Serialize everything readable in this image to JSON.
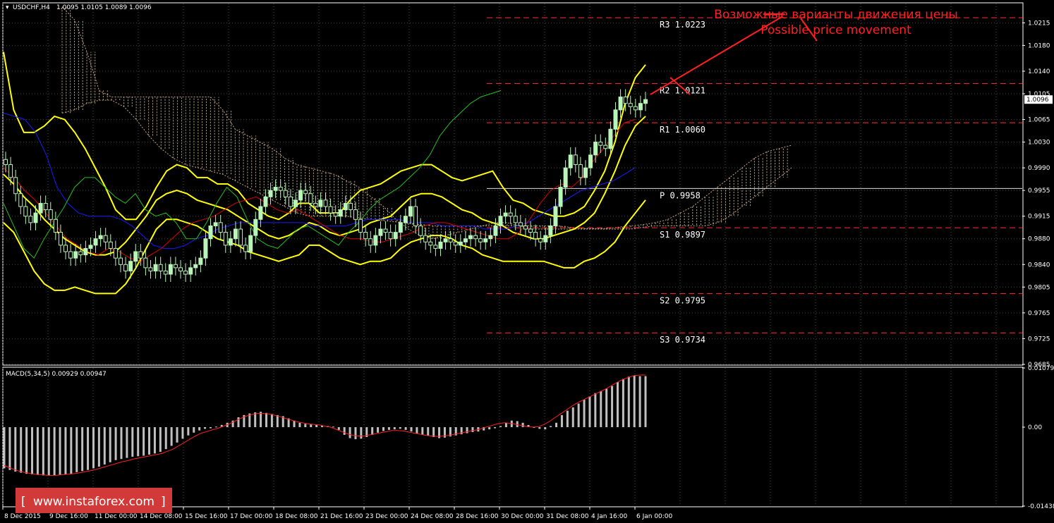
{
  "header": {
    "symbol": "USDCHF,H4",
    "ohlc": "1.0095 1.0105 1.0089 1.0096",
    "macd_label": "MACD(5,34,5) 0.00929 0.00947"
  },
  "annotation": {
    "line_ru": "Возможные варианты движения цены",
    "line_en": "Possible price movement"
  },
  "logo": {
    "text": "www.instaforex.com",
    "bracket_left": "[",
    "bracket_right": "]"
  },
  "current_price": {
    "label": "1.0096",
    "value": 1.0096
  },
  "colors": {
    "background": "#000000",
    "grid": "#3a4a3a",
    "axis": "#ffffff",
    "bull_candle": "#b9f5b9",
    "bear_candle": "#000000",
    "wick": "#b9f5b9",
    "bollinger": "#ffff00",
    "level_line": "#ff3030",
    "macd_hist": "#c0c0c0",
    "macd_signal": "#ff2020",
    "ichimoku_tenkan": "#e00000",
    "ichimoku_kijun": "#1a1aff",
    "ichimoku_chikou": "#22c022",
    "ichimoku_cloud": "#d9c7a7",
    "annotation": "#ff2020",
    "logo_bg": "#d23a3a"
  },
  "chart_data": [
    {
      "type": "candlestick",
      "title": "USDCHF,H4",
      "ylim": [
        0.9685,
        1.0245
      ],
      "y_ticks": [
        "1.0215",
        "1.0180",
        "1.0140",
        "1.0105",
        "1.0065",
        "1.0030",
        "0.9990",
        "0.9955",
        "0.9915",
        "0.9880",
        "0.9840",
        "0.9805",
        "0.9765",
        "0.9725",
        "0.9685"
      ],
      "x_ticks": [
        "8 Dec 2015",
        "9 Dec 16:00",
        "11 Dec 00:00",
        "14 Dec 08:00",
        "15 Dec 16:00",
        "17 Dec 00:00",
        "18 Dec 08:00",
        "21 Dec 16:00",
        "23 Dec 00:00",
        "24 Dec 08:00",
        "28 Dec 16:00",
        "30 Dec 00:00",
        "31 Dec 08:00",
        "4 Jan 16:00",
        "6 Jan 00:00"
      ],
      "pivot_levels": [
        {
          "name": "R3",
          "label": "R3  1.0223",
          "value": 1.0223
        },
        {
          "name": "R2",
          "label": "R2  1.0121",
          "value": 1.0121
        },
        {
          "name": "R1",
          "label": "R1  1.0060",
          "value": 1.006
        },
        {
          "name": "P",
          "label": " P  0.9958",
          "value": 0.9958
        },
        {
          "name": "S1",
          "label": "S1  0.9897",
          "value": 0.9897
        },
        {
          "name": "S2",
          "label": "S2  0.9795",
          "value": 0.9795
        },
        {
          "name": "S3",
          "label": "S3  0.9734",
          "value": 0.9734
        }
      ],
      "close": [
        0.9995,
        0.9975,
        0.995,
        0.993,
        0.9915,
        0.9905,
        0.992,
        0.9935,
        0.9925,
        0.991,
        0.989,
        0.987,
        0.986,
        0.985,
        0.986,
        0.9855,
        0.9865,
        0.987,
        0.988,
        0.9885,
        0.9875,
        0.9865,
        0.985,
        0.984,
        0.983,
        0.9845,
        0.986,
        0.985,
        0.9835,
        0.983,
        0.984,
        0.983,
        0.9825,
        0.984,
        0.9835,
        0.983,
        0.9825,
        0.9835,
        0.984,
        0.985,
        0.988,
        0.99,
        0.9905,
        0.989,
        0.987,
        0.988,
        0.9895,
        0.987,
        0.986,
        0.9885,
        0.991,
        0.993,
        0.9945,
        0.9955,
        0.996,
        0.9955,
        0.9945,
        0.993,
        0.994,
        0.9955,
        0.995,
        0.9935,
        0.993,
        0.994,
        0.993,
        0.992,
        0.9915,
        0.9925,
        0.9935,
        0.9925,
        0.991,
        0.989,
        0.988,
        0.987,
        0.9885,
        0.9895,
        0.989,
        0.988,
        0.989,
        0.9905,
        0.9915,
        0.993,
        0.99,
        0.9885,
        0.9875,
        0.987,
        0.9865,
        0.9875,
        0.988,
        0.9875,
        0.987,
        0.9875,
        0.988,
        0.9885,
        0.988,
        0.9875,
        0.988,
        0.9885,
        0.99,
        0.9915,
        0.992,
        0.9915,
        0.9905,
        0.99,
        0.9895,
        0.989,
        0.988,
        0.9875,
        0.9885,
        0.99,
        0.993,
        0.996,
        0.999,
        1.001,
        0.9995,
        0.9975,
        0.999,
        1.001,
        1.003,
        1.0025,
        1.002,
        1.005,
        1.008,
        1.01,
        1.009,
        1.0085,
        1.008,
        1.009,
        1.0096
      ],
      "bollinger_upper": [
        1.017,
        1.008,
        1.0045,
        1.0045,
        1.0055,
        1.007,
        1.0065,
        1.0045,
        1.002,
        0.999,
        0.996,
        0.9925,
        0.991,
        0.991,
        0.993,
        0.996,
        0.9985,
        0.9995,
        0.999,
        0.9975,
        0.9975,
        0.9965,
        0.9965,
        0.9955,
        0.9935,
        0.9925,
        0.9915,
        0.991,
        0.992,
        0.9935,
        0.9935,
        0.992,
        0.992,
        0.992,
        0.994,
        0.9955,
        0.996,
        0.9965,
        0.9975,
        0.9985,
        0.999,
        0.9995,
        0.9995,
        0.9985,
        0.9975,
        0.997,
        0.9975,
        0.998,
        0.9985,
        0.996,
        0.994,
        0.9935,
        0.9925,
        0.992,
        0.9915,
        0.9915,
        0.992,
        0.993,
        0.9955,
        0.9985,
        1.003,
        1.009,
        1.013,
        1.015
      ],
      "bollinger_middle": [
        0.998,
        0.9965,
        0.9945,
        0.993,
        0.991,
        0.9895,
        0.988,
        0.987,
        0.986,
        0.9855,
        0.9855,
        0.986,
        0.9875,
        0.9895,
        0.9915,
        0.994,
        0.995,
        0.9955,
        0.995,
        0.994,
        0.9935,
        0.993,
        0.9925,
        0.9915,
        0.9905,
        0.9895,
        0.9885,
        0.988,
        0.9885,
        0.9895,
        0.9905,
        0.99,
        0.989,
        0.9885,
        0.989,
        0.9895,
        0.9905,
        0.991,
        0.9915,
        0.993,
        0.9945,
        0.995,
        0.995,
        0.9945,
        0.9935,
        0.9925,
        0.992,
        0.991,
        0.9905,
        0.99,
        0.989,
        0.9885,
        0.988,
        0.988,
        0.9885,
        0.989,
        0.9895,
        0.9905,
        0.992,
        0.995,
        0.9985,
        1.0025,
        1.0055,
        1.007
      ],
      "bollinger_lower": [
        0.9905,
        0.989,
        0.986,
        0.983,
        0.981,
        0.98,
        0.98,
        0.9805,
        0.98,
        0.9795,
        0.9795,
        0.9795,
        0.981,
        0.9835,
        0.9865,
        0.9895,
        0.991,
        0.991,
        0.9905,
        0.99,
        0.989,
        0.988,
        0.9875,
        0.987,
        0.986,
        0.9855,
        0.985,
        0.9845,
        0.985,
        0.9855,
        0.987,
        0.987,
        0.986,
        0.985,
        0.9845,
        0.984,
        0.9845,
        0.9845,
        0.985,
        0.9865,
        0.9875,
        0.988,
        0.9885,
        0.9885,
        0.988,
        0.987,
        0.9865,
        0.9855,
        0.985,
        0.9845,
        0.9845,
        0.9845,
        0.9845,
        0.9845,
        0.984,
        0.9835,
        0.9835,
        0.9845,
        0.985,
        0.986,
        0.9875,
        0.99,
        0.992,
        0.994
      ],
      "tenkan": [
        0.999,
        0.9975,
        0.9955,
        0.994,
        0.992,
        0.99,
        0.988,
        0.987,
        0.986,
        0.9855,
        0.9865,
        0.986,
        0.985,
        0.9845,
        0.9855,
        0.9865,
        0.988,
        0.9895,
        0.9905,
        0.991,
        0.9915,
        0.9925,
        0.9935,
        0.994,
        0.9945,
        0.9935,
        0.9925,
        0.992,
        0.9925,
        0.9915,
        0.9905,
        0.9895,
        0.9885,
        0.988,
        0.988,
        0.9875,
        0.9875,
        0.988,
        0.9885,
        0.989,
        0.99,
        0.9905,
        0.9905,
        0.99,
        0.9895,
        0.989,
        0.9885,
        0.988,
        0.988,
        0.989,
        0.991,
        0.9935,
        0.9955,
        0.9965,
        0.996,
        0.9975,
        1.0,
        1.002,
        1.004,
        1.006,
        1.0065
      ],
      "kijun": [
        1.0075,
        1.007,
        1.0065,
        1.0045,
        1.001,
        0.996,
        0.9935,
        0.992,
        0.9915,
        0.9915,
        0.9915,
        0.991,
        0.99,
        0.9885,
        0.987,
        0.9865,
        0.9865,
        0.987,
        0.988,
        0.9885,
        0.9895,
        0.99,
        0.9905,
        0.9905,
        0.9905,
        0.9905,
        0.9905,
        0.9905,
        0.9905,
        0.99,
        0.99,
        0.99,
        0.99,
        0.9905,
        0.991,
        0.991,
        0.991,
        0.991,
        0.9905,
        0.9905,
        0.9905,
        0.99,
        0.99,
        0.99,
        0.99,
        0.9895,
        0.9895,
        0.9895,
        0.99,
        0.9905,
        0.9915,
        0.9925,
        0.9935,
        0.9945,
        0.9955,
        0.996,
        0.9965,
        0.997,
        0.998,
        0.999
      ],
      "chikou": [
        0.9935,
        0.99,
        0.9865,
        0.985,
        0.988,
        0.9905,
        0.993,
        0.996,
        0.9975,
        0.9975,
        0.996,
        0.9945,
        0.9935,
        0.995,
        0.9925,
        0.9915,
        0.992,
        0.9905,
        0.988,
        0.988,
        0.9905,
        0.9935,
        0.996,
        0.9945,
        0.991,
        0.988,
        0.987,
        0.9865,
        0.988,
        0.9895,
        0.99,
        0.989,
        0.988,
        0.987,
        0.989,
        0.9905,
        0.9925,
        0.994,
        0.995,
        0.996,
        0.9975,
        0.999,
        1.001,
        1.004,
        1.006,
        1.0075,
        1.009,
        1.01,
        1.0105,
        1.011
      ],
      "senkou_a": [
        1.0075,
        1.008,
        1.009,
        1.0095,
        1.0095,
        1.0085,
        1.0065,
        1.004,
        1.002,
        1.0005,
        0.9995,
        0.999,
        0.9985,
        0.998,
        0.997,
        0.996,
        0.995,
        0.994,
        0.993,
        0.992,
        0.9915,
        0.9915,
        0.9915,
        0.9915,
        0.9912,
        0.991,
        0.9908,
        0.9906,
        0.9904,
        0.9902,
        0.99,
        0.99,
        0.99,
        0.99,
        0.99,
        0.99,
        0.99,
        0.99,
        0.99,
        0.99,
        0.99,
        0.9898,
        0.9896,
        0.9896,
        0.9896,
        0.9898,
        0.99,
        0.9902,
        0.9905,
        0.991,
        0.992,
        0.993,
        0.9945,
        0.996,
        0.9975,
        0.999,
        1.0005,
        1.0015,
        1.002,
        1.0025
      ],
      "senkou_b": [
        1.024,
        1.022,
        1.017,
        1.011,
        1.01,
        1.01,
        1.01,
        1.01,
        1.01,
        1.01,
        1.01,
        1.01,
        1.01,
        1.008,
        1.005,
        1.004,
        1.003,
        1.002,
        1.0005,
        0.9995,
        0.999,
        0.9985,
        0.998,
        0.997,
        0.996,
        0.9945,
        0.993,
        0.991,
        0.9895,
        0.9885,
        0.988,
        0.9885,
        0.989,
        0.9895,
        0.99,
        0.9905,
        0.9905,
        0.99,
        0.9895,
        0.9895,
        0.9895,
        0.9895,
        0.9895,
        0.9895,
        0.9895,
        0.9895,
        0.9895,
        0.9898,
        0.99,
        0.99,
        0.99,
        0.99,
        0.99,
        0.9905,
        0.9915,
        0.993,
        0.9945,
        0.996,
        0.9975,
        0.999
      ]
    },
    {
      "type": "bar",
      "title": "MACD(5,34,5) 0.00929 0.00947",
      "ylim": [
        -0.01438,
        0.01079
      ],
      "y_ticks": [
        "0.01079",
        "0.00",
        "-0.01438"
      ],
      "histogram": [
        -0.0075,
        -0.0078,
        -0.0081,
        -0.0083,
        -0.0085,
        -0.0086,
        -0.0087,
        -0.0088,
        -0.0088,
        -0.0088,
        -0.0087,
        -0.0086,
        -0.0085,
        -0.0082,
        -0.008,
        -0.0078,
        -0.0075,
        -0.0072,
        -0.0068,
        -0.0064,
        -0.006,
        -0.0058,
        -0.0056,
        -0.0054,
        -0.0053,
        -0.0052,
        -0.005,
        -0.0048,
        -0.0045,
        -0.004,
        -0.0034,
        -0.0028,
        -0.0021,
        -0.0015,
        -0.001,
        -0.0006,
        -0.0003,
        -0.0002,
        0.0001,
        0.0004,
        0.0008,
        0.0012,
        0.0018,
        0.0022,
        0.0025,
        0.0027,
        0.0028,
        0.0026,
        0.0024,
        0.0022,
        0.002,
        0.0016,
        0.0012,
        0.0008,
        0.0006,
        0.0005,
        0.0004,
        0.0003,
        0.0002,
        0.0001,
        -0.0005,
        -0.0014,
        -0.002,
        -0.0022,
        -0.0021,
        -0.0018,
        -0.0014,
        -0.001,
        -0.0007,
        -0.0005,
        -0.0004,
        -0.0003,
        -0.0005,
        -0.0008,
        -0.0012,
        -0.0014,
        -0.0016,
        -0.0018,
        -0.002,
        -0.0019,
        -0.0017,
        -0.0015,
        -0.0013,
        -0.0011,
        -0.0009,
        -0.0008,
        -0.0006,
        -0.0004,
        -0.0002,
        0.0002,
        0.0008,
        0.0012,
        0.0011,
        0.0008,
        0.0004,
        0.0,
        -0.0003,
        -0.0004,
        0.0002,
        0.0008,
        0.0022,
        0.003,
        0.0036,
        0.0043,
        0.005,
        0.0056,
        0.0062,
        0.0066,
        0.007,
        0.0075,
        0.0082,
        0.0088,
        0.0092,
        0.0094,
        0.0093,
        0.0093
      ],
      "signal": [
        -0.007,
        -0.0074,
        -0.0078,
        -0.0081,
        -0.0083,
        -0.0085,
        -0.0086,
        -0.0087,
        -0.0088,
        -0.0088,
        -0.0087,
        -0.0086,
        -0.0085,
        -0.0084,
        -0.0082,
        -0.008,
        -0.0078,
        -0.0075,
        -0.0072,
        -0.0069,
        -0.0066,
        -0.0063,
        -0.0061,
        -0.0058,
        -0.0056,
        -0.0054,
        -0.0052,
        -0.005,
        -0.0048,
        -0.0044,
        -0.004,
        -0.0034,
        -0.0028,
        -0.0022,
        -0.0016,
        -0.0011,
        -0.0008,
        -0.0005,
        -0.0002,
        0.0002,
        0.0006,
        0.0011,
        0.0016,
        0.002,
        0.0023,
        0.0025,
        0.0025,
        0.0024,
        0.0022,
        0.0019,
        0.0016,
        0.0013,
        0.001,
        0.0008,
        0.0006,
        0.0005,
        0.0004,
        0.0002,
        0.0,
        -0.0004,
        -0.0008,
        -0.0012,
        -0.0015,
        -0.0016,
        -0.0016,
        -0.0014,
        -0.0012,
        -0.001,
        -0.0008,
        -0.0006,
        -0.0006,
        -0.0007,
        -0.0009,
        -0.0011,
        -0.0013,
        -0.0015,
        -0.0016,
        -0.0017,
        -0.0016,
        -0.0015,
        -0.0013,
        -0.0011,
        -0.0009,
        -0.0007,
        -0.0005,
        -0.0002,
        0.0001,
        0.0004,
        0.0007,
        0.0008,
        0.0007,
        0.0005,
        0.0003,
        0.0001,
        0.0,
        0.0001,
        0.0005,
        0.0011,
        0.0018,
        0.0025,
        0.0032,
        0.0039,
        0.0045,
        0.005,
        0.0055,
        0.006,
        0.0065,
        0.007,
        0.0076,
        0.0082,
        0.0087,
        0.0091,
        0.0094,
        0.0095,
        0.0095
      ]
    }
  ]
}
